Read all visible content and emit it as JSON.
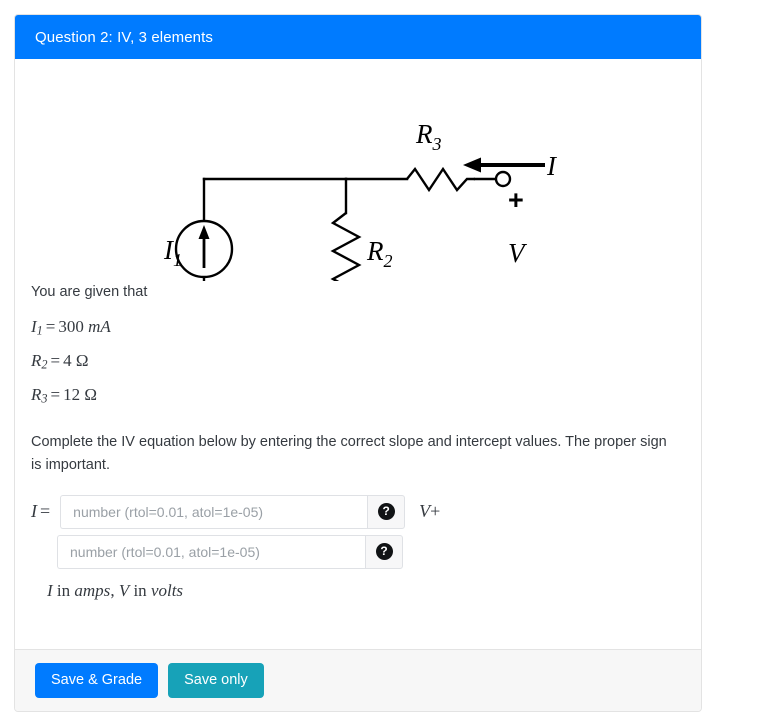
{
  "card": {
    "header_title": "Question 2: IV, 3 elements"
  },
  "circuit": {
    "labels": {
      "source": "I",
      "source_sub": "1",
      "r2": "R",
      "r2_sub": "2",
      "r3": "R",
      "r3_sub": "3",
      "current": "I",
      "voltage": "V",
      "plus": "+",
      "minus": "−"
    }
  },
  "given": {
    "intro": "You are given that",
    "lines": [
      {
        "sym": "I",
        "sub": "1",
        "eq": "=",
        "value": "300",
        "unit": "mA"
      },
      {
        "sym": "R",
        "sub": "2",
        "eq": "=",
        "value": "4",
        "unit": "Ω"
      },
      {
        "sym": "R",
        "sub": "3",
        "eq": "=",
        "value": "12",
        "unit": "Ω"
      }
    ]
  },
  "instructions": "Complete the IV equation below by entering the correct slope and intercept values. The proper sign is important.",
  "answer": {
    "eq_symbol": "I",
    "eq_sign": "=",
    "slope_placeholder": "number (rtol=0.01, atol=1e-05)",
    "slope_value": "",
    "intercept_placeholder": "number (rtol=0.01, atol=1e-05)",
    "intercept_value": "",
    "help_glyph": "?",
    "suffix_var": "V",
    "suffix_plus": "+",
    "units_note_parts": {
      "i": "I",
      "in1": " in ",
      "amps": "amps",
      "comma": ", ",
      "v": "V",
      "in2": " in ",
      "volts": "volts"
    }
  },
  "footer": {
    "save_grade_label": "Save & Grade",
    "save_only_label": "Save only"
  },
  "colors": {
    "header_blue": "#007bff",
    "primary_button": "#007bff",
    "teal_button": "#17a2b8",
    "footer_bg": "#f7f7f7",
    "body_text": "#353a40"
  }
}
